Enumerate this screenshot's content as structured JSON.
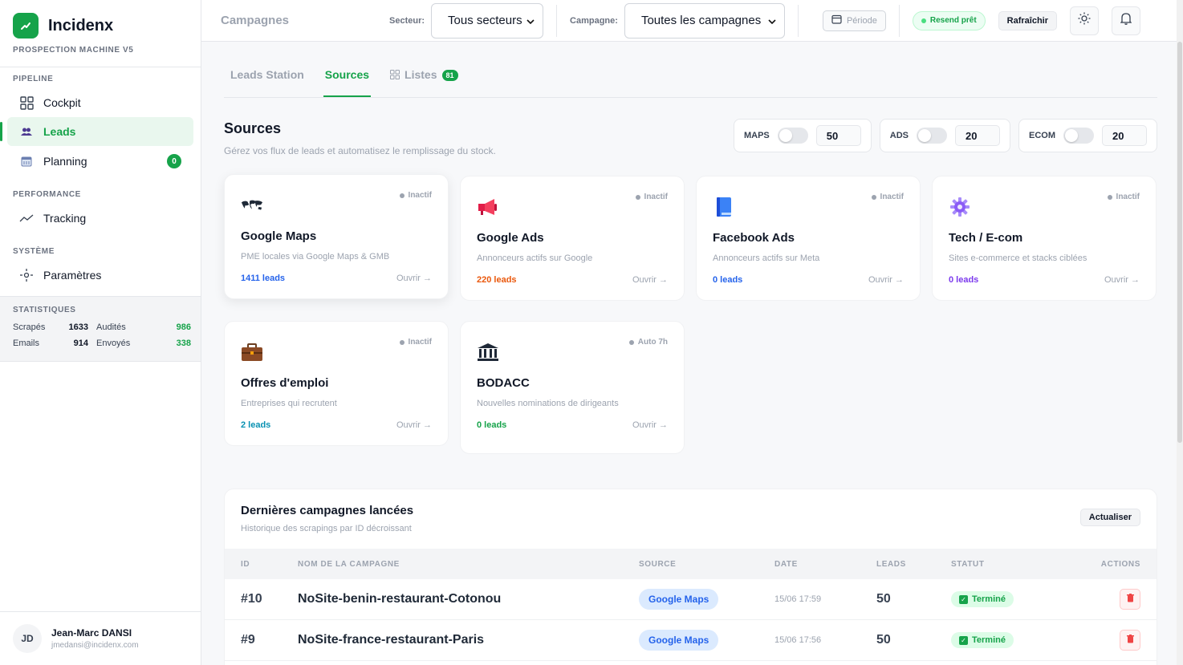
{
  "brand": {
    "name": "Incidenx",
    "subtitle": "PROSPECTION MACHINE V5"
  },
  "sidebar": {
    "sections": [
      {
        "label": "PIPELINE"
      },
      {
        "label": "PERFORMANCE"
      },
      {
        "label": "SYSTÈME"
      }
    ],
    "items": [
      {
        "label": "Cockpit",
        "icon": "grid-icon"
      },
      {
        "label": "Leads",
        "icon": "users-icon",
        "active": true
      },
      {
        "label": "Planning",
        "icon": "calendar-icon",
        "count": "0"
      },
      {
        "label": "Tracking",
        "icon": "trend-icon"
      },
      {
        "label": "Paramètres",
        "icon": "settings-icon"
      }
    ]
  },
  "stats": {
    "title": "STATISTIQUES",
    "scrapes_label": "Scrapés",
    "scrapes_value": "1633",
    "audited_label": "Audités",
    "audited_value": "986",
    "emails_label": "Emails",
    "emails_value": "914",
    "sent_label": "Envoyés",
    "sent_value": "338"
  },
  "user": {
    "initials": "JD",
    "name": "Jean-Marc DANSI",
    "email": "jmedansi@incidenx.com"
  },
  "topbar": {
    "title": "Campagnes",
    "sector_label": "Secteur:",
    "sector_value": "Tous secteurs",
    "campaign_label": "Campagne:",
    "campaign_value": "Toutes les campagnes",
    "period_label": "Période",
    "resend_label": "Resend prêt",
    "refresh_label": "Rafraîchir"
  },
  "tabs": [
    {
      "label": "Leads Station"
    },
    {
      "label": "Sources",
      "active": true
    },
    {
      "label": "Listes",
      "count": "81"
    }
  ],
  "sources": {
    "title": "Sources",
    "subtitle": "Gérez vos flux de leads et automatisez le remplissage du stock.",
    "quotas": [
      {
        "label": "MAPS",
        "value": "50",
        "enabled": false
      },
      {
        "label": "ADS",
        "value": "20",
        "enabled": false
      },
      {
        "label": "ECOM",
        "value": "20",
        "enabled": false
      }
    ],
    "cards": [
      {
        "title": "Google Maps",
        "desc": "PME locales via Google Maps & GMB",
        "leads": "1411 leads",
        "leads_color": "#2563eb",
        "status": "Inactif",
        "open": "Ouvrir →",
        "icon": "world-map-icon"
      },
      {
        "title": "Google Ads",
        "desc": "Annonceurs actifs sur Google",
        "leads": "220 leads",
        "leads_color": "#ea580c",
        "status": "Inactif",
        "open": "Ouvrir →",
        "icon": "megaphone-icon"
      },
      {
        "title": "Facebook Ads",
        "desc": "Annonceurs actifs sur Meta",
        "leads": "0 leads",
        "leads_color": "#2563eb",
        "status": "Inactif",
        "open": "Ouvrir →",
        "icon": "book-icon"
      },
      {
        "title": "Tech / E-com",
        "desc": "Sites e-commerce et stacks ciblées",
        "leads": "0 leads",
        "leads_color": "#7c3aed",
        "status": "Inactif",
        "open": "Ouvrir →",
        "icon": "gear-icon"
      },
      {
        "title": "Offres d'emploi",
        "desc": "Entreprises qui recrutent",
        "leads": "2 leads",
        "leads_color": "#0891b2",
        "status": "Inactif",
        "open": "Ouvrir →",
        "icon": "briefcase-icon"
      },
      {
        "title": "BODACC",
        "desc": "Nouvelles nominations de dirigeants",
        "leads": "0 leads",
        "leads_color": "#16a34a",
        "status": "Auto 7h",
        "open": "Ouvrir →",
        "icon": "bank-icon"
      }
    ]
  },
  "history": {
    "title": "Dernières campagnes lancées",
    "subtitle": "Historique des scrapings par ID décroissant",
    "update_label": "Actualiser",
    "columns": [
      "ID",
      "NOM DE LA CAMPAGNE",
      "SOURCE",
      "DATE",
      "LEADS",
      "STATUT",
      "ACTIONS"
    ],
    "rows": [
      {
        "id": "#10",
        "name": "NoSite-benin-restaurant-Cotonou",
        "source": "Google Maps",
        "date": "15/06 17:59",
        "leads": "50",
        "status": "Terminé"
      },
      {
        "id": "#9",
        "name": "NoSite-france-restaurant-Paris",
        "source": "Google Maps",
        "date": "15/06 17:56",
        "leads": "50",
        "status": "Terminé"
      }
    ]
  },
  "colors": {
    "accent": "#16a34a",
    "blue": "#2563eb",
    "orange": "#ea580c",
    "purple": "#7c3aed",
    "cyan": "#0891b2"
  }
}
